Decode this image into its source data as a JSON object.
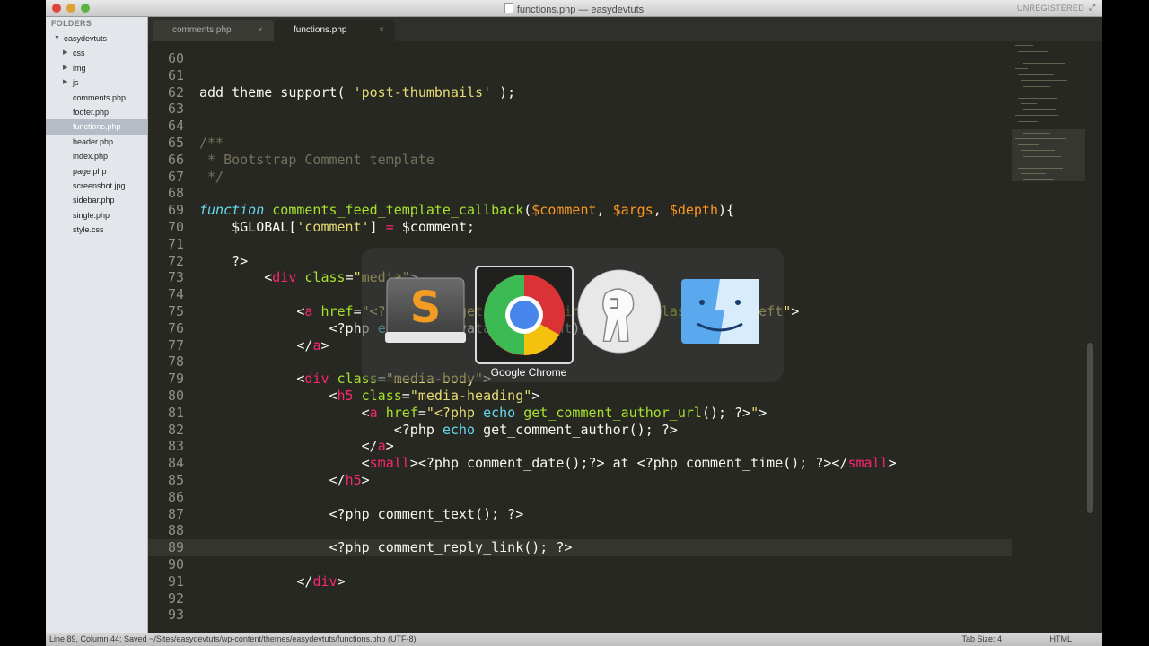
{
  "window": {
    "title": "functions.php — easydevtuts",
    "registration": "UNREGISTERED"
  },
  "sidebar": {
    "header": "FOLDERS",
    "root": "easydevtuts",
    "folders": [
      "css",
      "img",
      "js"
    ],
    "files": [
      "comments.php",
      "footer.php",
      "functions.php",
      "header.php",
      "index.php",
      "page.php",
      "screenshot.jpg",
      "sidebar.php",
      "single.php",
      "style.css"
    ],
    "selected": "functions.php"
  },
  "tabs": [
    {
      "label": "comments.php",
      "active": false
    },
    {
      "label": "functions.php",
      "active": true
    }
  ],
  "editor": {
    "current_line": 89,
    "lines": [
      {
        "n": "60",
        "html": ""
      },
      {
        "n": "61",
        "html": ""
      },
      {
        "n": "62",
        "html": "add_theme_support( <span class='s'>'post-thumbnails'</span> );"
      },
      {
        "n": "63",
        "html": ""
      },
      {
        "n": "64",
        "html": ""
      },
      {
        "n": "65",
        "html": "<span class='c'>/**</span>"
      },
      {
        "n": "66",
        "html": "<span class='c'> * Bootstrap Comment template</span>"
      },
      {
        "n": "67",
        "html": "<span class='c'> */</span>"
      },
      {
        "n": "68",
        "html": ""
      },
      {
        "n": "69",
        "html": "<span class='k'>function</span> <span class='f'>comments_feed_template_callback</span>(<span class='v'>$comment</span>, <span class='v'>$args</span>, <span class='v'>$depth</span>){"
      },
      {
        "n": "70",
        "html": "    $GLOBAL[<span class='s'>'comment'</span>] <span class='t'>=</span> $comment;"
      },
      {
        "n": "71",
        "html": ""
      },
      {
        "n": "72",
        "html": "    ?>"
      },
      {
        "n": "73",
        "html": "        &lt;<span class='t'>div</span> <span class='a'>class</span>=<span class='s'>\"media\"</span>>"
      },
      {
        "n": "74",
        "html": ""
      },
      {
        "n": "75",
        "html": "            &lt;<span class='t'>a</span> <span class='a'>href</span>=<span class='s'>\"&lt;?php echo get_comment_link(); ?>\"</span> <span class='a'>class</span>=<span class='s'>\"pull-left\"</span>>"
      },
      {
        "n": "76",
        "html": "                &lt;?php <span class='b'>echo</span> get_avatar($comment); ?>"
      },
      {
        "n": "77",
        "html": "            &lt;/<span class='t'>a</span>>"
      },
      {
        "n": "78",
        "html": ""
      },
      {
        "n": "79",
        "html": "            &lt;<span class='t'>div</span> <span class='a'>class</span>=<span class='s'>\"media-body\"</span>>"
      },
      {
        "n": "80",
        "html": "                &lt;<span class='t'>h5</span> <span class='a'>class</span>=<span class='s'>\"media-heading\"</span>>"
      },
      {
        "n": "81",
        "html": "                    &lt;<span class='t'>a</span> <span class='a'>href</span>=<span class='s'>\"&lt;?php</span> <span class='b'>echo</span> <span class='f'>get_comment_author_url</span>(); ?><span class='s'>\"</span>>"
      },
      {
        "n": "82",
        "html": "                        &lt;?php <span class='b'>echo</span> get_comment_author(); ?>"
      },
      {
        "n": "83",
        "html": "                    &lt;/<span class='t'>a</span>>"
      },
      {
        "n": "84",
        "html": "                    &lt;<span class='t'>small</span>>&lt;?php comment_date();?> at &lt;?php comment_time(); ?>&lt;/<span class='t'>small</span>>"
      },
      {
        "n": "85",
        "html": "                &lt;/<span class='t'>h5</span>>"
      },
      {
        "n": "86",
        "html": ""
      },
      {
        "n": "87",
        "html": "                &lt;?php comment_text(); ?>"
      },
      {
        "n": "88",
        "html": ""
      },
      {
        "n": "89",
        "html": "                &lt;?php comment_reply_link(); ?>"
      },
      {
        "n": "90",
        "html": ""
      },
      {
        "n": "91",
        "html": "            &lt;/<span class='t'>div</span>>"
      },
      {
        "n": "92",
        "html": ""
      },
      {
        "n": "93",
        "html": ""
      }
    ]
  },
  "app_switcher": {
    "apps": [
      "Sublime Text",
      "Google Chrome",
      "Sequel Pro",
      "Finder"
    ],
    "selected_label": "Google Chrome"
  },
  "statusbar": {
    "left": "Line 89, Column 44; Saved ~/Sites/easydevtuts/wp-content/themes/easydevtuts/functions.php (UTF-8)",
    "tab_size": "Tab Size: 4",
    "syntax": "HTML"
  },
  "colors": {
    "editor_bg": "#272822",
    "string": "#e6db74",
    "comment": "#75715e",
    "keyword": "#66d9ef",
    "function": "#a6e22e",
    "tag": "#f92672"
  }
}
